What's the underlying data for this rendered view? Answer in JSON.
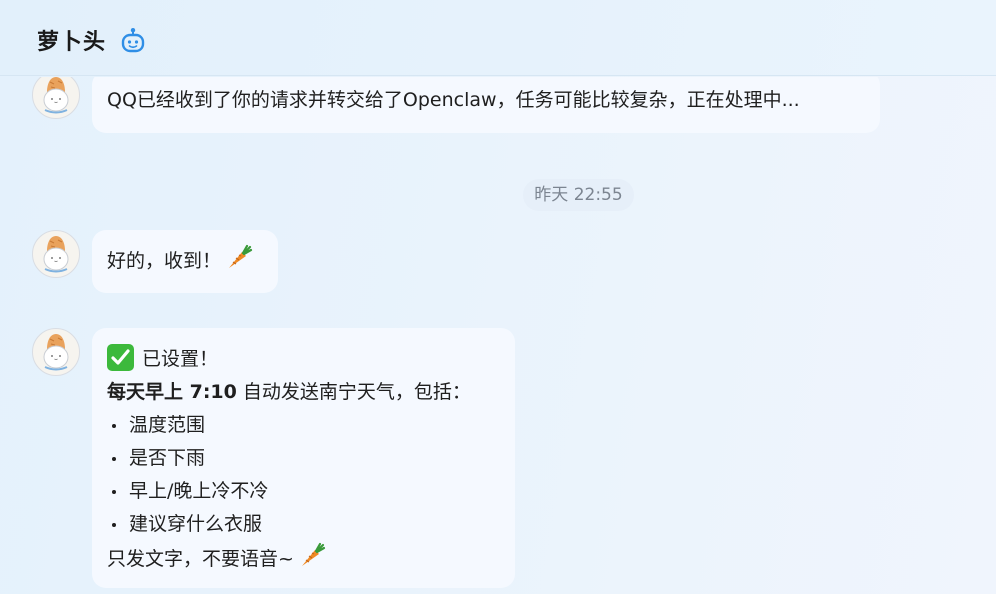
{
  "header": {
    "title": "萝卜头",
    "bot_icon": "robot-icon"
  },
  "messages": [
    {
      "sender": "bot",
      "text": "QQ已经收到了你的请求并转交给了Openclaw，任务可能比较复杂，正在处理中..."
    },
    {
      "type": "timestamp",
      "text": "昨天 22:55"
    },
    {
      "sender": "bot",
      "text": "好的，收到！",
      "emoji": "carrot-emoji"
    },
    {
      "sender": "bot",
      "heading": "已设置！",
      "heading_icon": "check-mark-icon",
      "schedule_bold": "每天早上 7:10",
      "schedule_rest": " 自动发送南宁天气，包括：",
      "items": [
        "温度范围",
        "是否下雨",
        "早上/晚上冷不冷",
        "建议穿什么衣服"
      ],
      "footer": "只发文字，不要语音~",
      "footer_emoji": "carrot-emoji"
    }
  ],
  "colors": {
    "bubble": "#f5f9ff",
    "timestamp_bg": "#e6eff9",
    "accent_icon": "#2f8ee6",
    "check": "#3cb93c",
    "carrot": "#f08a24"
  }
}
